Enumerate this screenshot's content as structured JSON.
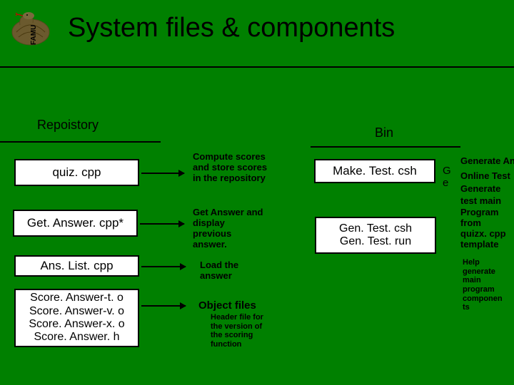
{
  "logo_text": "FAMU",
  "title": "System files & components",
  "sections": {
    "repo": "Repoistory",
    "bin": "Bin"
  },
  "left_boxes": {
    "quiz": "quiz. cpp",
    "getanswer": "Get. Answer. cpp*",
    "anslist": "Ans. List. cpp",
    "score0": "Score. Answer-t. o",
    "score1": "Score. Answer-v. o",
    "score2": "Score. Answer-x. o",
    "score3": "Score. Answer. h"
  },
  "mid_desc": {
    "quiz": "Compute scores and store scores in the repository",
    "getanswer": "Get Answer and display previous answer.",
    "anslist": "Load the answer",
    "obj": "Object files",
    "header": "Header file for the version of the scoring function"
  },
  "right_boxes": {
    "make": "Make. Test. csh",
    "gen0": "Gen. Test. csh",
    "gen1": "Gen. Test. run"
  },
  "ge": {
    "line0": "G",
    "line1": "e"
  },
  "right_desc": {
    "l0": "Generate An",
    "l1": "Online Test",
    "l2": "Generate",
    "l3": " test main",
    "l4": "Program from quizx. cpp template",
    "help": "Help generate main program componen ts"
  }
}
